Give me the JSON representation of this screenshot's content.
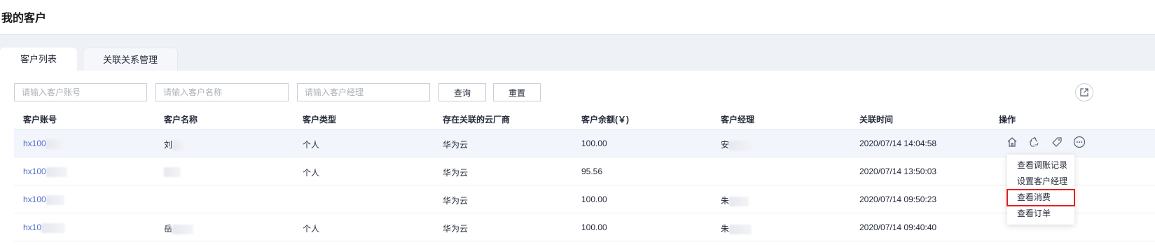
{
  "page": {
    "title": "我的客户"
  },
  "tabs": [
    {
      "label": "客户列表",
      "active": true
    },
    {
      "label": "关联关系管理",
      "active": false
    }
  ],
  "filters": {
    "account_placeholder": "请输入客户账号",
    "name_placeholder": "请输入客户名称",
    "manager_placeholder": "请输入客户经理",
    "search_label": "查询",
    "reset_label": "重置"
  },
  "table": {
    "columns": [
      "客户账号",
      "客户名称",
      "客户类型",
      "存在关联的云厂商",
      "客户余额(￥)",
      "客户经理",
      "关联时间",
      "操作"
    ],
    "rows": [
      {
        "account": "hx100",
        "name": "刘",
        "type": "个人",
        "vendor": "华为云",
        "balance": "100.00",
        "manager": "安",
        "time": "2020/07/14 14:04:58"
      },
      {
        "account": "hx100",
        "name": "",
        "type": "个人",
        "vendor": "华为云",
        "balance": "95.56",
        "manager": "",
        "time": "2020/07/14 13:50:03"
      },
      {
        "account": "hx100",
        "name": "",
        "type": "",
        "vendor": "华为云",
        "balance": "100.00",
        "manager": "朱",
        "time": "2020/07/14 09:50:23"
      },
      {
        "account": "hx10",
        "name": "岳",
        "type": "个人",
        "vendor": "华为云",
        "balance": "100.00",
        "manager": "朱",
        "time": "2020/07/14 09:40:40"
      }
    ]
  },
  "row_menu": {
    "items": [
      "查看调账记录",
      "设置客户经理",
      "查看消费",
      "查看订单"
    ],
    "highlighted": "查看消费"
  },
  "icons": {
    "export": "export-icon",
    "ops": [
      "house-icon",
      "recycle-icon",
      "tag-icon",
      "more-icon"
    ]
  },
  "colors": {
    "link": "#526ecc",
    "highlight": "#e02020",
    "hover_row": "#f2f5fc"
  }
}
